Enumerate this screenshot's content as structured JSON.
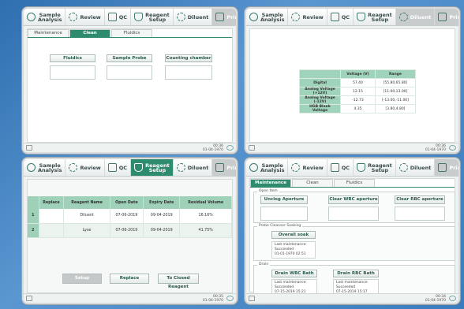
{
  "nav": {
    "sample": "Sample\nAnalysis",
    "review": "Review",
    "qc": "QC",
    "reagent": "Reagent\nSetup",
    "diluent": "Diluent",
    "print": "Print"
  },
  "clock": {
    "time": "00:36",
    "date": "01-04-1970"
  },
  "clock2": {
    "time": "00:36",
    "date": "01-04-1970"
  },
  "clock3": {
    "time": "00:35",
    "date": "01-04-1970"
  },
  "clock4": {
    "time": "00:34",
    "date": "01-04-1970"
  },
  "screen1": {
    "tabs": [
      "Maintenance",
      "Clean",
      "Fluidics"
    ],
    "buttons": [
      "Fluidics",
      "Sample Probe",
      "Counting chamber"
    ]
  },
  "screen2": {
    "headers": [
      "",
      "Voltage (V)",
      "Range"
    ],
    "rows": [
      {
        "name": "Digital",
        "voltage": "57.40",
        "range": "[55.80,65.80]"
      },
      {
        "name": "Analog Voltage\n(+12V)",
        "voltage": "12.15",
        "range": "[11.00,13.00]"
      },
      {
        "name": "Analog Voltage\n(-12V)",
        "voltage": "-12.73",
        "range": "[-13.00,-11.00]"
      },
      {
        "name": "HGB Blank\nVoltage",
        "voltage": "4.35",
        "range": "[3.80,4.80]"
      }
    ]
  },
  "screen3": {
    "headers": [
      "",
      "Replace",
      "Reagent Name",
      "Open Date",
      "Expiry Date",
      "Residual Volume"
    ],
    "rows": [
      {
        "idx": "1",
        "replace": "",
        "name": "Diluent",
        "open": "07-06-2019",
        "expiry": "09-04-2019",
        "residual": "16.16%"
      },
      {
        "idx": "2",
        "replace": "",
        "name": "Lyse",
        "open": "07-06-2019",
        "expiry": "09-04-2019",
        "residual": "41.75%"
      }
    ],
    "buttons": [
      "Setup",
      "Replace",
      "To Closed Reagent"
    ]
  },
  "screen4": {
    "tabs": [
      "Maintenance",
      "Clean",
      "Fluidics"
    ],
    "section1": {
      "label": "Open Item",
      "buttons": [
        "Unclog Aperture",
        "Clear WBC aperture",
        "Clear RBC aperture"
      ]
    },
    "section2": {
      "label": "Probe Cleanser Soaking",
      "button": "Overall soak",
      "info": [
        "Last maintenance:",
        "Succeeded",
        "01-01-1970 02:51"
      ]
    },
    "section3": {
      "label": "Drain",
      "btn1": "Drain WBC Bath",
      "btn2": "Drain RBC Bath",
      "info1": [
        "Last maintenance:",
        "Succeeded",
        "07-15-2019 15:21"
      ],
      "info2": [
        "Last maintenance:",
        "Succeeded",
        "07-15-2019 15:17"
      ]
    }
  }
}
